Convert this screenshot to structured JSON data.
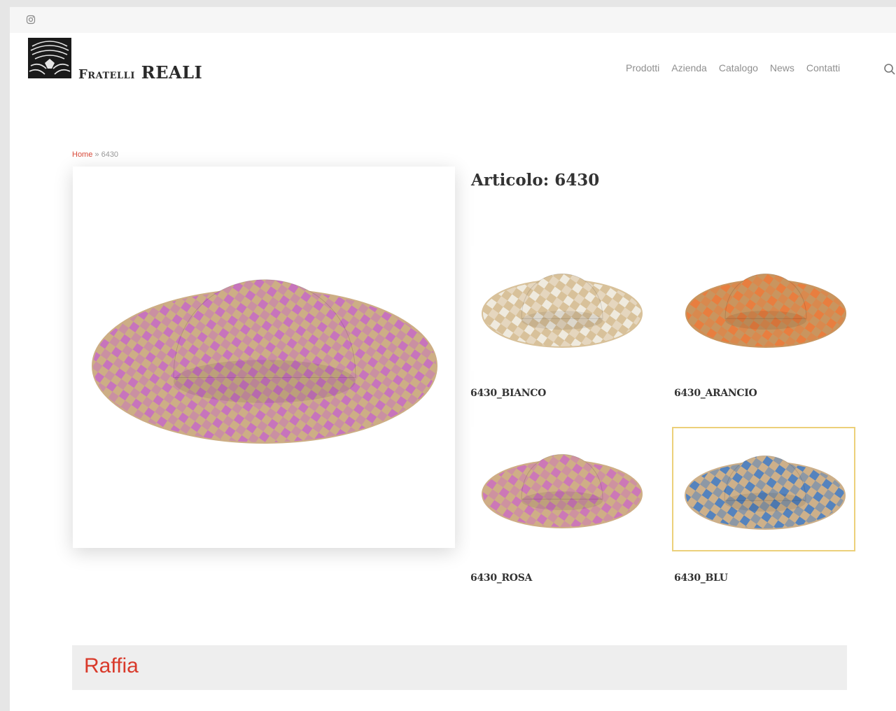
{
  "header": {
    "logo_text_small": "Fratelli",
    "logo_text_big": "REALI",
    "nav": [
      "Prodotti",
      "Azienda",
      "Catalogo",
      "News",
      "Contatti"
    ]
  },
  "breadcrumb": {
    "home": "Home",
    "separator": " » ",
    "current": "6430"
  },
  "product": {
    "title": "Articolo: 6430",
    "variants": [
      {
        "label": "6430_BIANCO",
        "color": "#d8c19a",
        "accent": "#f4f1ea",
        "selected": false
      },
      {
        "label": "6430_ARANCIO",
        "color": "#c9955f",
        "accent": "#ee7a3a",
        "selected": false
      },
      {
        "label": "6430_ROSA",
        "color": "#cfae86",
        "accent": "#cc6fc0",
        "selected": false
      },
      {
        "label": "6430_BLU",
        "color": "#cdb08a",
        "accent": "#3f7bc6",
        "selected": true
      }
    ],
    "main_image": {
      "color": "#cdae85",
      "accent": "#c66ac6"
    }
  },
  "material": {
    "label": "Raffia"
  },
  "colors": {
    "brand_red": "#d93a2b",
    "selected_border": "#ecd07a"
  }
}
